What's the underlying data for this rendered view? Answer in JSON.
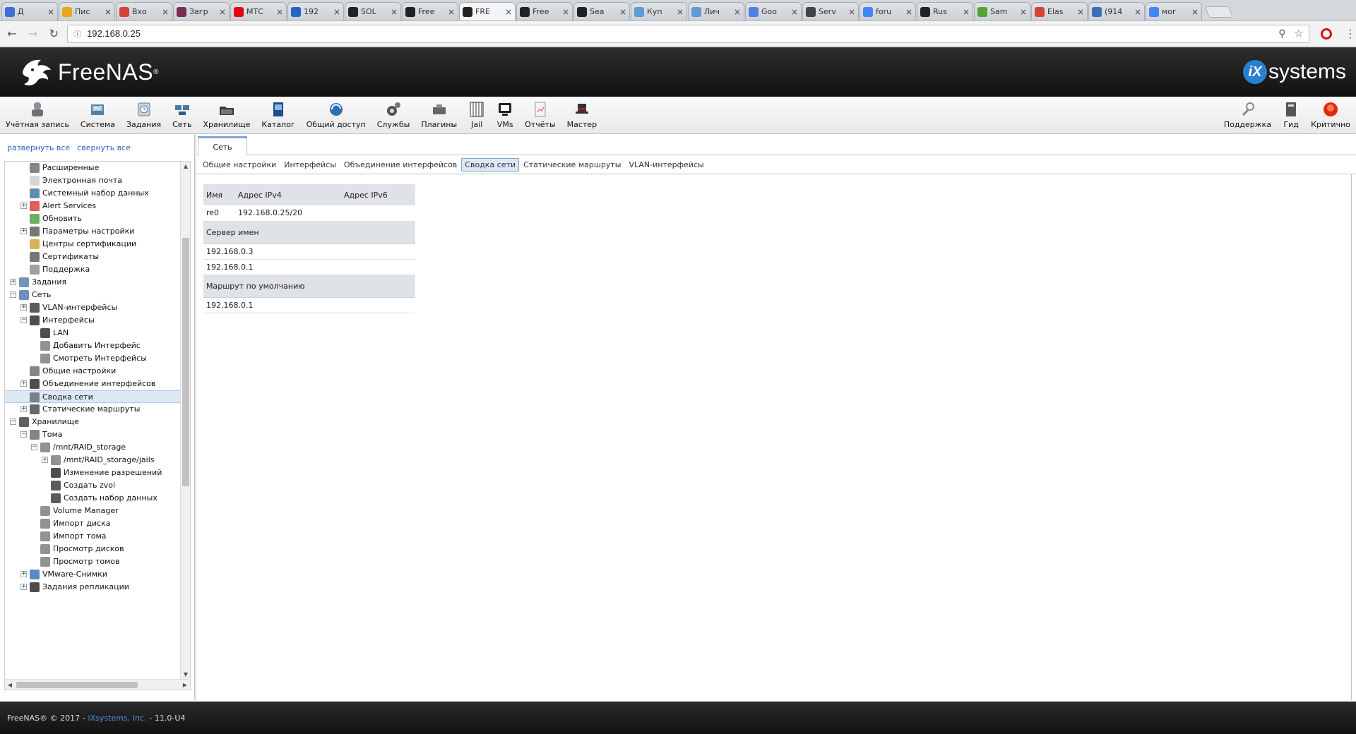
{
  "browser": {
    "tabs": [
      {
        "title": "Д",
        "color": "#3c6fd1"
      },
      {
        "title": "Пис",
        "color": "#e9a61c"
      },
      {
        "title": "Вхо",
        "color": "#d64235"
      },
      {
        "title": "Загр",
        "color": "#7a2b53"
      },
      {
        "title": "МТС",
        "color": "#e30611"
      },
      {
        "title": "192",
        "color": "#2566c3"
      },
      {
        "title": "SOL",
        "color": "#222222"
      },
      {
        "title": "Free",
        "color": "#222222"
      },
      {
        "title": "FRE",
        "color": "#222222",
        "active": true
      },
      {
        "title": "Free",
        "color": "#222222"
      },
      {
        "title": "Sea",
        "color": "#222222"
      },
      {
        "title": "Куп",
        "color": "#5c9ad8"
      },
      {
        "title": "Лич",
        "color": "#5c9ad8"
      },
      {
        "title": "Goo",
        "color": "#4f7fe0"
      },
      {
        "title": "Serv",
        "color": "#444444"
      },
      {
        "title": "foru",
        "color": "#4285f4"
      },
      {
        "title": "Rus",
        "color": "#222222"
      },
      {
        "title": "Sam",
        "color": "#55a331"
      },
      {
        "title": "Elas",
        "color": "#d64235"
      },
      {
        "title": "(914",
        "color": "#3a6fb3"
      },
      {
        "title": "мог",
        "color": "#4285f4"
      }
    ],
    "url": "192.168.0.25"
  },
  "header": {
    "logo_text": "FreeNAS",
    "logo_mark": "®",
    "vendor_text": "systems",
    "vendor_mark": "iX"
  },
  "toolbar": {
    "left": [
      {
        "label": "Учётная запись",
        "icon": "account-icon"
      },
      {
        "label": "Система",
        "icon": "system-icon"
      },
      {
        "label": "Задания",
        "icon": "tasks-icon"
      },
      {
        "label": "Сеть",
        "icon": "network-icon"
      },
      {
        "label": "Хранилище",
        "icon": "storage-icon"
      },
      {
        "label": "Каталог",
        "icon": "directory-icon"
      },
      {
        "label": "Общий доступ",
        "icon": "sharing-icon"
      },
      {
        "label": "Службы",
        "icon": "services-icon"
      },
      {
        "label": "Плагины",
        "icon": "plugins-icon"
      },
      {
        "label": "Jail",
        "icon": "jail-icon"
      },
      {
        "label": "VMs",
        "icon": "vms-icon"
      },
      {
        "label": "Отчёты",
        "icon": "reports-icon"
      },
      {
        "label": "Мастер",
        "icon": "wizard-icon"
      }
    ],
    "right": [
      {
        "label": "Поддержка",
        "icon": "support-icon"
      },
      {
        "label": "Гид",
        "icon": "guide-icon"
      },
      {
        "label": "Критично",
        "icon": "alert-icon"
      }
    ]
  },
  "sidebar": {
    "expand_all": "развернуть все",
    "collapse_all": "свернуть все",
    "tree": [
      {
        "label": "Расширенные",
        "level": 2,
        "icon": "wrench-icon"
      },
      {
        "label": "Электронная почта",
        "level": 2,
        "icon": "email-icon"
      },
      {
        "label": "Системный набор данных",
        "level": 2,
        "icon": "dataset-icon"
      },
      {
        "label": "Alert Services",
        "level": 2,
        "icon": "alert-services-icon",
        "toggle": "+"
      },
      {
        "label": "Обновить",
        "level": 2,
        "icon": "update-icon"
      },
      {
        "label": "Параметры настройки",
        "level": 2,
        "icon": "tunables-icon",
        "toggle": "+"
      },
      {
        "label": "Центры сертификации",
        "level": 2,
        "icon": "ca-icon"
      },
      {
        "label": "Сертификаты",
        "level": 2,
        "icon": "certificate-icon"
      },
      {
        "label": "Поддержка",
        "level": 2,
        "icon": "support-icon"
      },
      {
        "label": "Задания",
        "level": 1,
        "icon": "tasks-icon",
        "toggle": "+"
      },
      {
        "label": "Сеть",
        "level": 1,
        "icon": "network-icon",
        "toggle": "−"
      },
      {
        "label": "VLAN-интерфейсы",
        "level": 2,
        "icon": "vlan-icon",
        "toggle": "+"
      },
      {
        "label": "Интерфейсы",
        "level": 2,
        "icon": "interfaces-icon",
        "toggle": "−"
      },
      {
        "label": "LAN",
        "level": 3,
        "icon": "interface-icon"
      },
      {
        "label": "Добавить Интерфейс",
        "level": 3,
        "icon": "add-icon"
      },
      {
        "label": "Смотреть Интерфейсы",
        "level": 3,
        "icon": "view-icon"
      },
      {
        "label": "Общие настройки",
        "level": 2,
        "icon": "wrench-icon"
      },
      {
        "label": "Объединение интерфейсов",
        "level": 2,
        "icon": "lagg-icon",
        "toggle": "+"
      },
      {
        "label": "Сводка сети",
        "level": 2,
        "icon": "wrench-icon",
        "selected": true
      },
      {
        "label": "Статические маршруты",
        "level": 2,
        "icon": "routes-icon",
        "toggle": "+"
      },
      {
        "label": "Хранилище",
        "level": 1,
        "icon": "storage-icon",
        "toggle": "−"
      },
      {
        "label": "Тома",
        "level": 2,
        "icon": "volumes-icon",
        "toggle": "−"
      },
      {
        "label": "/mnt/RAID_storage",
        "level": 3,
        "icon": "volume-icon",
        "toggle": "−"
      },
      {
        "label": "/mnt/RAID_storage/jails",
        "level": 4,
        "icon": "volume-icon",
        "toggle": "+"
      },
      {
        "label": "Изменение разрешений",
        "level": 4,
        "icon": "key-icon"
      },
      {
        "label": "Создать zvol",
        "level": 4,
        "icon": "zvol-icon"
      },
      {
        "label": "Создать набор данных",
        "level": 4,
        "icon": "zvol-icon"
      },
      {
        "label": "Volume Manager",
        "level": 3,
        "icon": "manager-icon"
      },
      {
        "label": "Импорт диска",
        "level": 3,
        "icon": "manager-icon"
      },
      {
        "label": "Импорт тома",
        "level": 3,
        "icon": "manager-icon"
      },
      {
        "label": "Просмотр дисков",
        "level": 3,
        "icon": "manager-icon"
      },
      {
        "label": "Просмотр томов",
        "level": 3,
        "icon": "manager-icon"
      },
      {
        "label": "VMware-Снимки",
        "level": 2,
        "icon": "vmware-icon",
        "toggle": "+"
      },
      {
        "label": "Задания репликации",
        "level": 2,
        "icon": "replication-icon",
        "toggle": "+"
      }
    ]
  },
  "content": {
    "tab": "Сеть",
    "subtabs": [
      "Общие настройки",
      "Интерфейсы",
      "Объединение интерфейсов",
      "Сводка сети",
      "Статические маршруты",
      "VLAN-интерфейсы"
    ],
    "active_subtab": "Сводка сети",
    "summary": {
      "headers": [
        "Имя",
        "Адрес IPv4",
        "Адрес IPv6"
      ],
      "rows": [
        [
          "re0",
          "192.168.0.25/20",
          ""
        ]
      ],
      "nameserver_title": "Сервер имен",
      "nameservers": [
        "192.168.0.3",
        "192.168.0.1"
      ],
      "gateway_title": "Маршрут по умолчанию",
      "gateways": [
        "192.168.0.1"
      ]
    }
  },
  "footer": {
    "copyright": "FreeNAS® © 2017 -",
    "company": "iXsystems, Inc.",
    "version": "- 11.0-U4"
  },
  "colors": {
    "accent": "#2c63b5",
    "selected_bg": "#dde8f5",
    "header_dark": "#1a1a1a",
    "critical": "#e02a10"
  }
}
